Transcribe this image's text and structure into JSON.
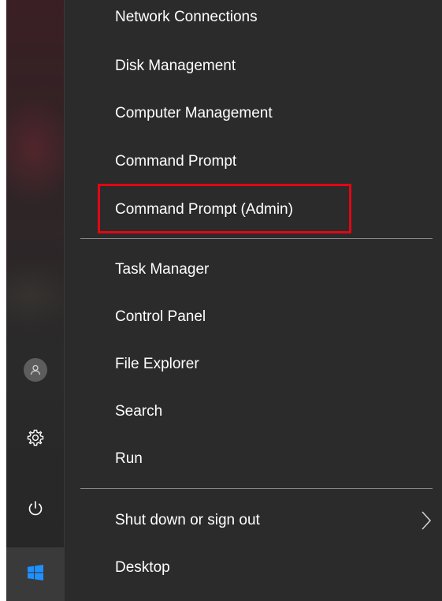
{
  "menu": {
    "items_group1": [
      {
        "label": "Network Connections"
      },
      {
        "label": "Disk Management"
      },
      {
        "label": "Computer Management"
      },
      {
        "label": "Command Prompt"
      },
      {
        "label": "Command Prompt (Admin)",
        "highlighted": true
      }
    ],
    "items_group2": [
      {
        "label": "Task Manager"
      },
      {
        "label": "Control Panel"
      },
      {
        "label": "File Explorer"
      },
      {
        "label": "Search"
      },
      {
        "label": "Run"
      }
    ],
    "items_group3": [
      {
        "label": "Shut down or sign out",
        "has_submenu": true
      },
      {
        "label": "Desktop"
      }
    ]
  },
  "sidebar": {
    "icons": [
      "user-icon",
      "settings-gear-icon",
      "power-icon",
      "windows-logo-icon"
    ]
  },
  "colors": {
    "menu_background": "#2b2b2b",
    "text": "#ffffff",
    "highlight_border": "#e30613",
    "separator": "#8a8a8a"
  }
}
